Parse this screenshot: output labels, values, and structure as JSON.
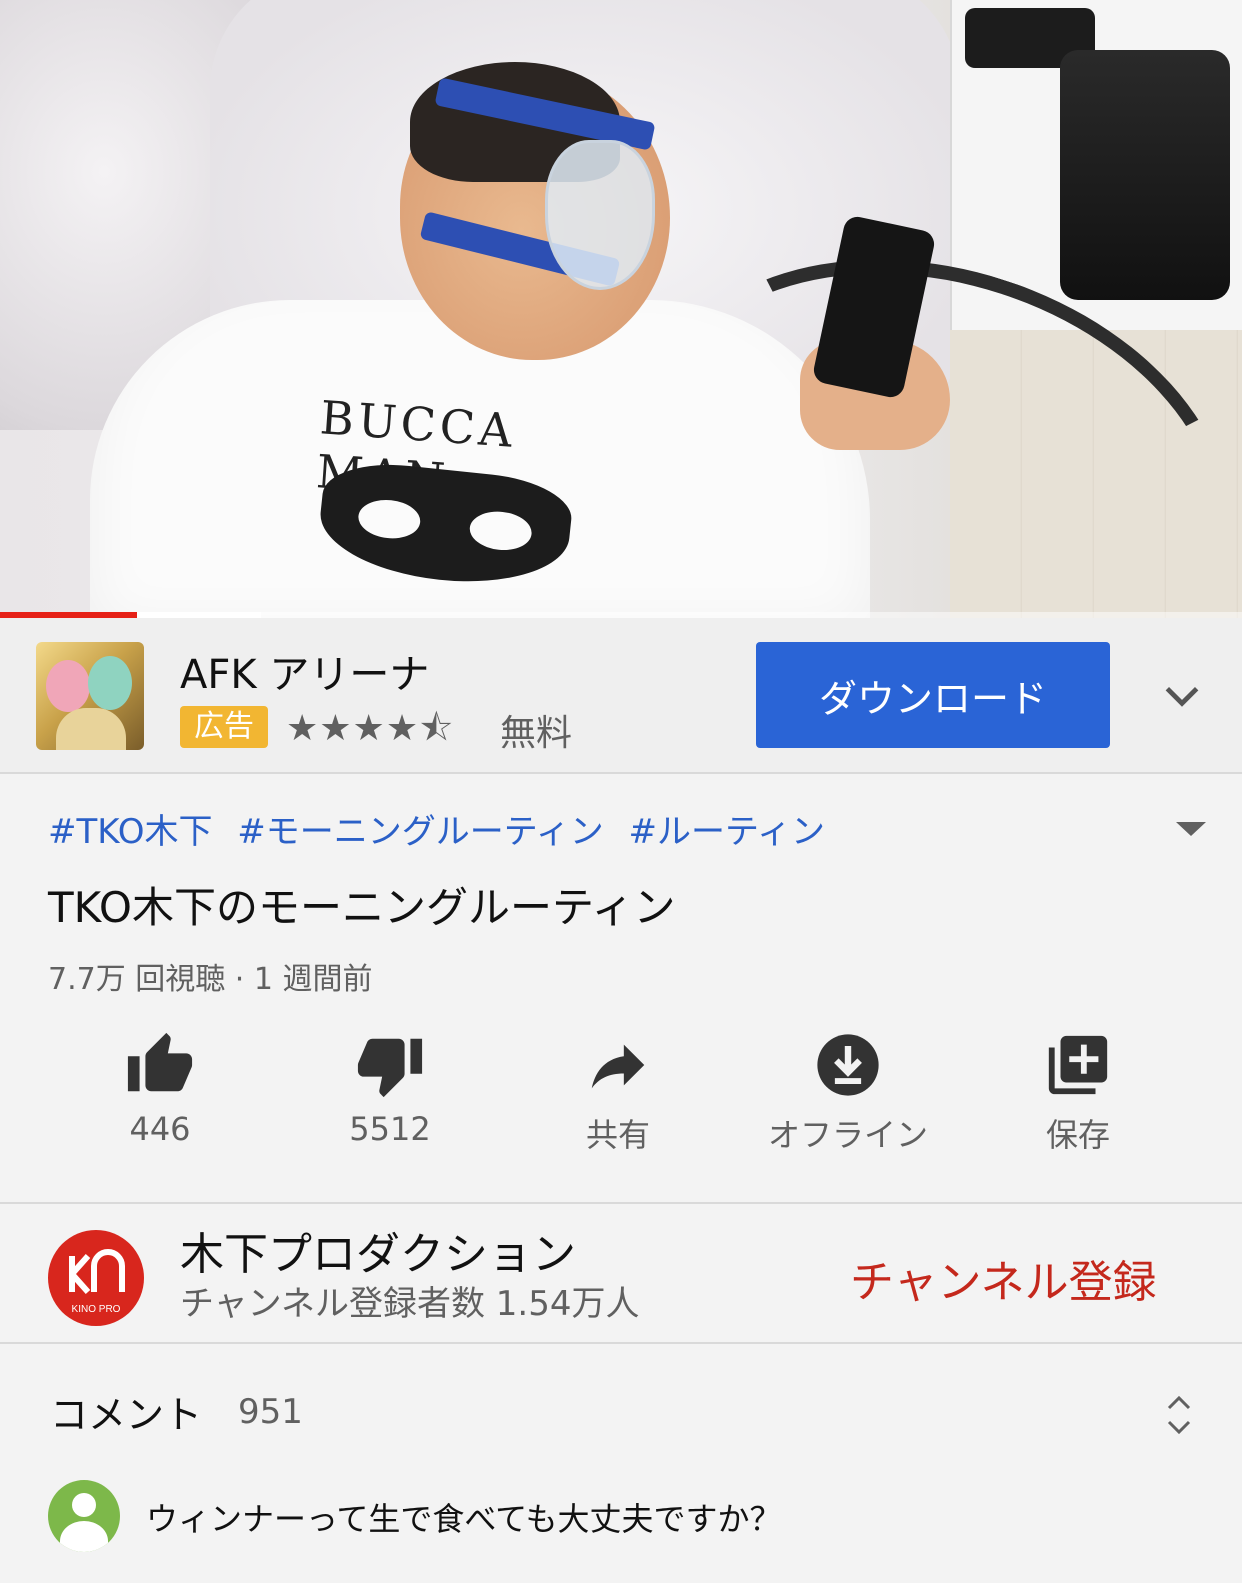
{
  "player": {
    "shirt_text": "BUCCA MAN",
    "progress_played": 0.11,
    "progress_buffered": 0.21
  },
  "ad": {
    "title": "AFK アリーナ",
    "badge": "広告",
    "rating_stars": "★★★★⯪",
    "price": "無料",
    "download_label": "ダウンロード",
    "icon": "chevron-down-icon"
  },
  "video": {
    "hashtags": [
      "#TKO木下",
      "#モーニングルーティン",
      "#ルーティン"
    ],
    "title": "TKO木下のモーニングルーティン",
    "meta": "7.7万 回視聴 · 1 週間前"
  },
  "actions": {
    "like": {
      "label": "446",
      "icon": "thumbs-up-icon"
    },
    "dislike": {
      "label": "5512",
      "icon": "thumbs-down-icon"
    },
    "share": {
      "label": "共有",
      "icon": "share-icon"
    },
    "offline": {
      "label": "オフライン",
      "icon": "download-icon"
    },
    "save": {
      "label": "保存",
      "icon": "playlist-add-icon"
    }
  },
  "channel": {
    "name": "木下プロダクション",
    "subscribers": "チャンネル登録者数 1.54万人",
    "subscribe_label": "チャンネル登録",
    "avatar_text": "KINO PRO"
  },
  "comments": {
    "label": "コメント",
    "count": "951",
    "input_placeholder": "ウィンナーって生で食べても大丈夫ですか？"
  },
  "colors": {
    "accent_blue": "#2a64d6",
    "hashtag_blue": "#2b60c7",
    "subscribe_red": "#c4281c",
    "progress_red": "#e62117",
    "ad_badge_yellow": "#f2b632"
  }
}
